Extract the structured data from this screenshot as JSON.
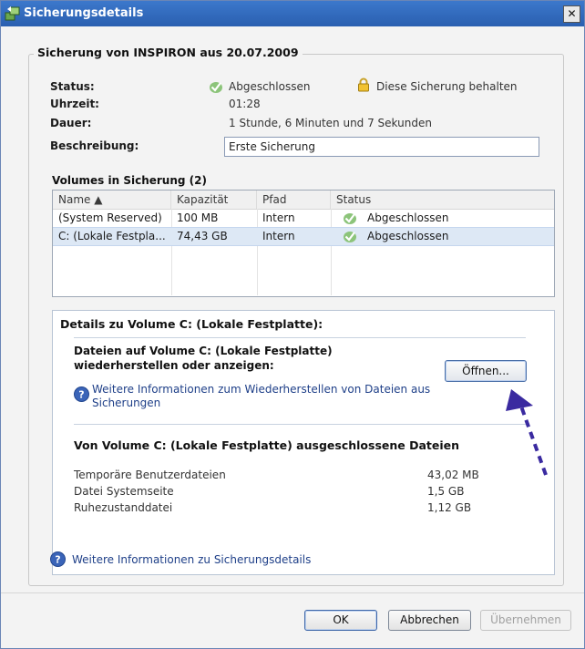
{
  "window": {
    "title": "Sicherungsdetails",
    "close_label": "✕"
  },
  "group": {
    "title": "Sicherung von INSPIRON aus 20.07.2009"
  },
  "info": {
    "status_label": "Status:",
    "status_value": "Abgeschlossen",
    "keep_backup": "Diese Sicherung behalten",
    "time_label": "Uhrzeit:",
    "time_value": "01:28",
    "duration_label": "Dauer:",
    "duration_value": "1 Stunde, 6 Minuten und 7 Sekunden",
    "description_label": "Beschreibung:",
    "description_value": "Erste Sicherung"
  },
  "volumes": {
    "heading": "Volumes in Sicherung (2)",
    "columns": [
      "Name ▲",
      "Kapazität",
      "Pfad",
      "Status"
    ],
    "rows": [
      {
        "name": "(System Reserved)",
        "capacity": "100 MB",
        "path": "Intern",
        "status": "Abgeschlossen"
      },
      {
        "name": "C: (Lokale Festpla...",
        "capacity": "74,43 GB",
        "path": "Intern",
        "status": "Abgeschlossen"
      }
    ]
  },
  "details": {
    "title": "Details zu Volume C: (Lokale Festplatte):",
    "files_title_line1": "Dateien auf Volume C: (Lokale Festplatte)",
    "files_title_line2": "wiederherstellen oder anzeigen:",
    "open_button": "Öffnen...",
    "help_link_line1": "Weitere Informationen zum Wiederherstellen von Dateien aus",
    "help_link_line2": "Sicherungen",
    "excluded_title": "Von Volume C: (Lokale Festplatte) ausgeschlossene Dateien",
    "excluded": [
      {
        "name": "Temporäre Benutzerdateien",
        "size": "43,02 MB"
      },
      {
        "name": "Datei Systemseite",
        "size": "1,5 GB"
      },
      {
        "name": "Ruhezustanddatei",
        "size": "1,12 GB"
      }
    ]
  },
  "footer_help": "Weitere Informationen zu Sicherungsdetails",
  "buttons": {
    "ok": "OK",
    "cancel": "Abbrechen",
    "apply": "Übernehmen"
  },
  "colors": {
    "accent_arrow": "#3a2aa0",
    "link": "#1e3f88"
  }
}
